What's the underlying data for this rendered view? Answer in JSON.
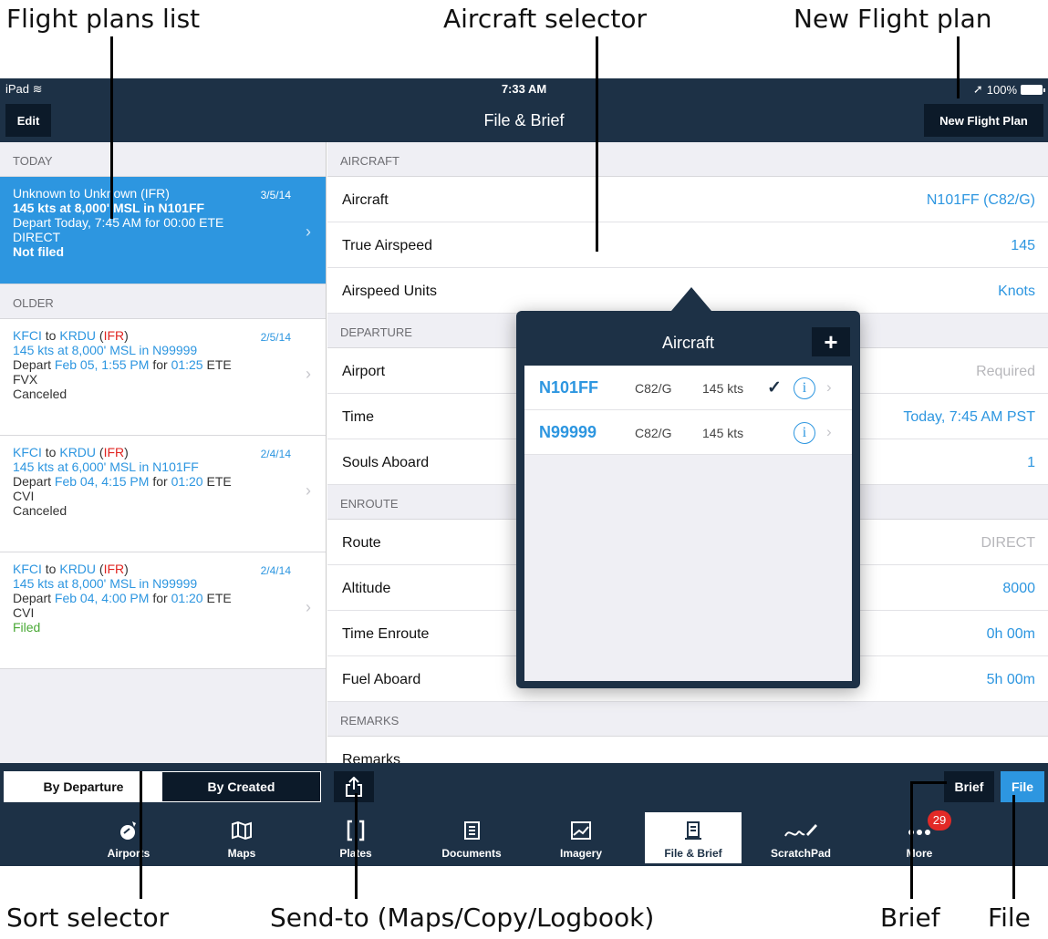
{
  "annotations": {
    "flight_plans_list": "Flight plans list",
    "aircraft_selector": "Aircraft selector",
    "new_flight_plan": "New Flight plan",
    "sort_selector": "Sort selector",
    "send_to": "Send-to (Maps/Copy/Logbook)",
    "brief": "Brief",
    "file": "File"
  },
  "status_bar": {
    "device": "iPad",
    "time": "7:33 AM",
    "battery": "100%"
  },
  "nav": {
    "edit_label": "Edit",
    "title": "File & Brief",
    "new_flight_plan_label": "New Flight Plan"
  },
  "flight_list": {
    "today_header": "TODAY",
    "older_header": "OLDER",
    "today": {
      "route": "Unknown to Unknown (IFR)",
      "date": "3/5/14",
      "line2": "145 kts at 8,000' MSL in N101FF",
      "line3": "Depart Today, 7:45 AM for 00:00 ETE",
      "line4": "DIRECT",
      "status": "Not filed"
    },
    "older": [
      {
        "from": "KFCI",
        "to": "KRDU",
        "rules": "IFR",
        "date": "2/5/14",
        "speed": "145 kts",
        "alt": "8,000' MSL",
        "tail": "N99999",
        "depart": "Feb 05, 1:55 PM",
        "ete": "01:25",
        "route": "FVX",
        "status": "Canceled"
      },
      {
        "from": "KFCI",
        "to": "KRDU",
        "rules": "IFR",
        "date": "2/4/14",
        "speed": "145 kts",
        "alt": "6,000' MSL",
        "tail": "N101FF",
        "depart": "Feb 04, 4:15 PM",
        "ete": "01:20",
        "route": "CVI",
        "status": "Canceled"
      },
      {
        "from": "KFCI",
        "to": "KRDU",
        "rules": "IFR",
        "date": "2/4/14",
        "speed": "145 kts",
        "alt": "8,000' MSL",
        "tail": "N99999",
        "depart": "Feb 04, 4:00 PM",
        "ete": "01:20",
        "route": "CVI",
        "status": "Filed"
      }
    ],
    "words": {
      "to": "to",
      "at": "at",
      "in": "in",
      "depart": "Depart",
      "for": "for",
      "ete": "ETE"
    }
  },
  "form": {
    "aircraft_header": "AIRCRAFT",
    "aircraft_label": "Aircraft",
    "aircraft_value": "N101FF (C82/G)",
    "tas_label": "True Airspeed",
    "tas_value": "145",
    "units_label": "Airspeed Units",
    "units_value": "Knots",
    "departure_header": "DEPARTURE",
    "airport_label": "Airport",
    "airport_value": "Required",
    "time_label": "Time",
    "time_value": "Today, 7:45 AM PST",
    "souls_label": "Souls Aboard",
    "souls_value": "1",
    "enroute_header": "ENROUTE",
    "route_label": "Route",
    "route_value": "DIRECT",
    "altitude_label": "Altitude",
    "altitude_value": "8000",
    "ete_label": "Time Enroute",
    "ete_value": "0h 00m",
    "fuel_label": "Fuel Aboard",
    "fuel_value": "5h 00m",
    "remarks_header": "REMARKS",
    "remarks_label": "Remarks"
  },
  "popover": {
    "title": "Aircraft",
    "add_label": "+",
    "aircraft": [
      {
        "tail": "N101FF",
        "type": "C82/G",
        "speed": "145 kts",
        "selected": true
      },
      {
        "tail": "N99999",
        "type": "C82/G",
        "speed": "145 kts",
        "selected": false
      }
    ],
    "check": "✓",
    "info": "i",
    "chevron": "›"
  },
  "toolbar": {
    "sort_departure": "By Departure",
    "sort_created": "By Created",
    "brief_label": "Brief",
    "file_label": "File",
    "share_icon": "share-icon"
  },
  "tabs": [
    {
      "label": "Airports",
      "icon": "airport-icon"
    },
    {
      "label": "Maps",
      "icon": "map-icon"
    },
    {
      "label": "Plates",
      "icon": "plates-icon"
    },
    {
      "label": "Documents",
      "icon": "documents-icon"
    },
    {
      "label": "Imagery",
      "icon": "imagery-icon"
    },
    {
      "label": "File & Brief",
      "icon": "file-brief-icon",
      "active": true
    },
    {
      "label": "ScratchPad",
      "icon": "scratchpad-icon"
    },
    {
      "label": "More",
      "icon": "more-icon",
      "badge": "29"
    }
  ],
  "colors": {
    "nav": "#1d3146",
    "accent": "#2d96e0",
    "button_dark": "#0c1a29",
    "badge": "#e22a27",
    "ifr": "#e0231f",
    "filed": "#4aa936"
  }
}
